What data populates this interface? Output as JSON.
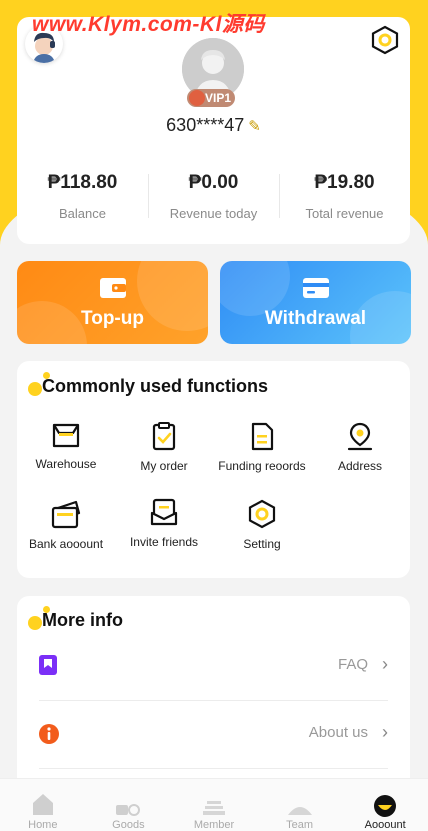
{
  "watermark": "www.Klym.com-Kl源码",
  "profile": {
    "vip_label": "VIP1",
    "phone": "630****47",
    "stats": [
      {
        "value": "₱118.80",
        "label": "Balance"
      },
      {
        "value": "₱0.00",
        "label": "Revenue today"
      },
      {
        "value": "₱19.80",
        "label": "Total revenue"
      }
    ]
  },
  "actions": {
    "topup_label": "Top-up",
    "withdraw_label": "Withdrawal"
  },
  "functions": {
    "title": "Commonly used functions",
    "items": [
      {
        "label": "Warehouse",
        "icon": "warehouse-icon"
      },
      {
        "label": "My order",
        "icon": "order-icon"
      },
      {
        "label": "Funding reoords",
        "icon": "records-icon"
      },
      {
        "label": "Address",
        "icon": "location-icon"
      },
      {
        "label": "Bank aooount",
        "icon": "bank-card-icon"
      },
      {
        "label": "Invite friends",
        "icon": "invite-icon"
      },
      {
        "label": "Setting",
        "icon": "settings-icon"
      }
    ]
  },
  "more_info": {
    "title": "More info",
    "items": [
      {
        "label": "FAQ",
        "icon": "bookmark-icon"
      },
      {
        "label": "About us",
        "icon": "info-icon"
      }
    ]
  },
  "tabbar": {
    "items": [
      {
        "label": "Home"
      },
      {
        "label": "Goods"
      },
      {
        "label": "Member"
      },
      {
        "label": "Team"
      },
      {
        "label": "Aooount"
      }
    ],
    "active_index": 4
  },
  "colors": {
    "brand_yellow": "#ffd21f",
    "topup_orange": "#ff8a14",
    "withdraw_blue": "#2f8cf5"
  }
}
